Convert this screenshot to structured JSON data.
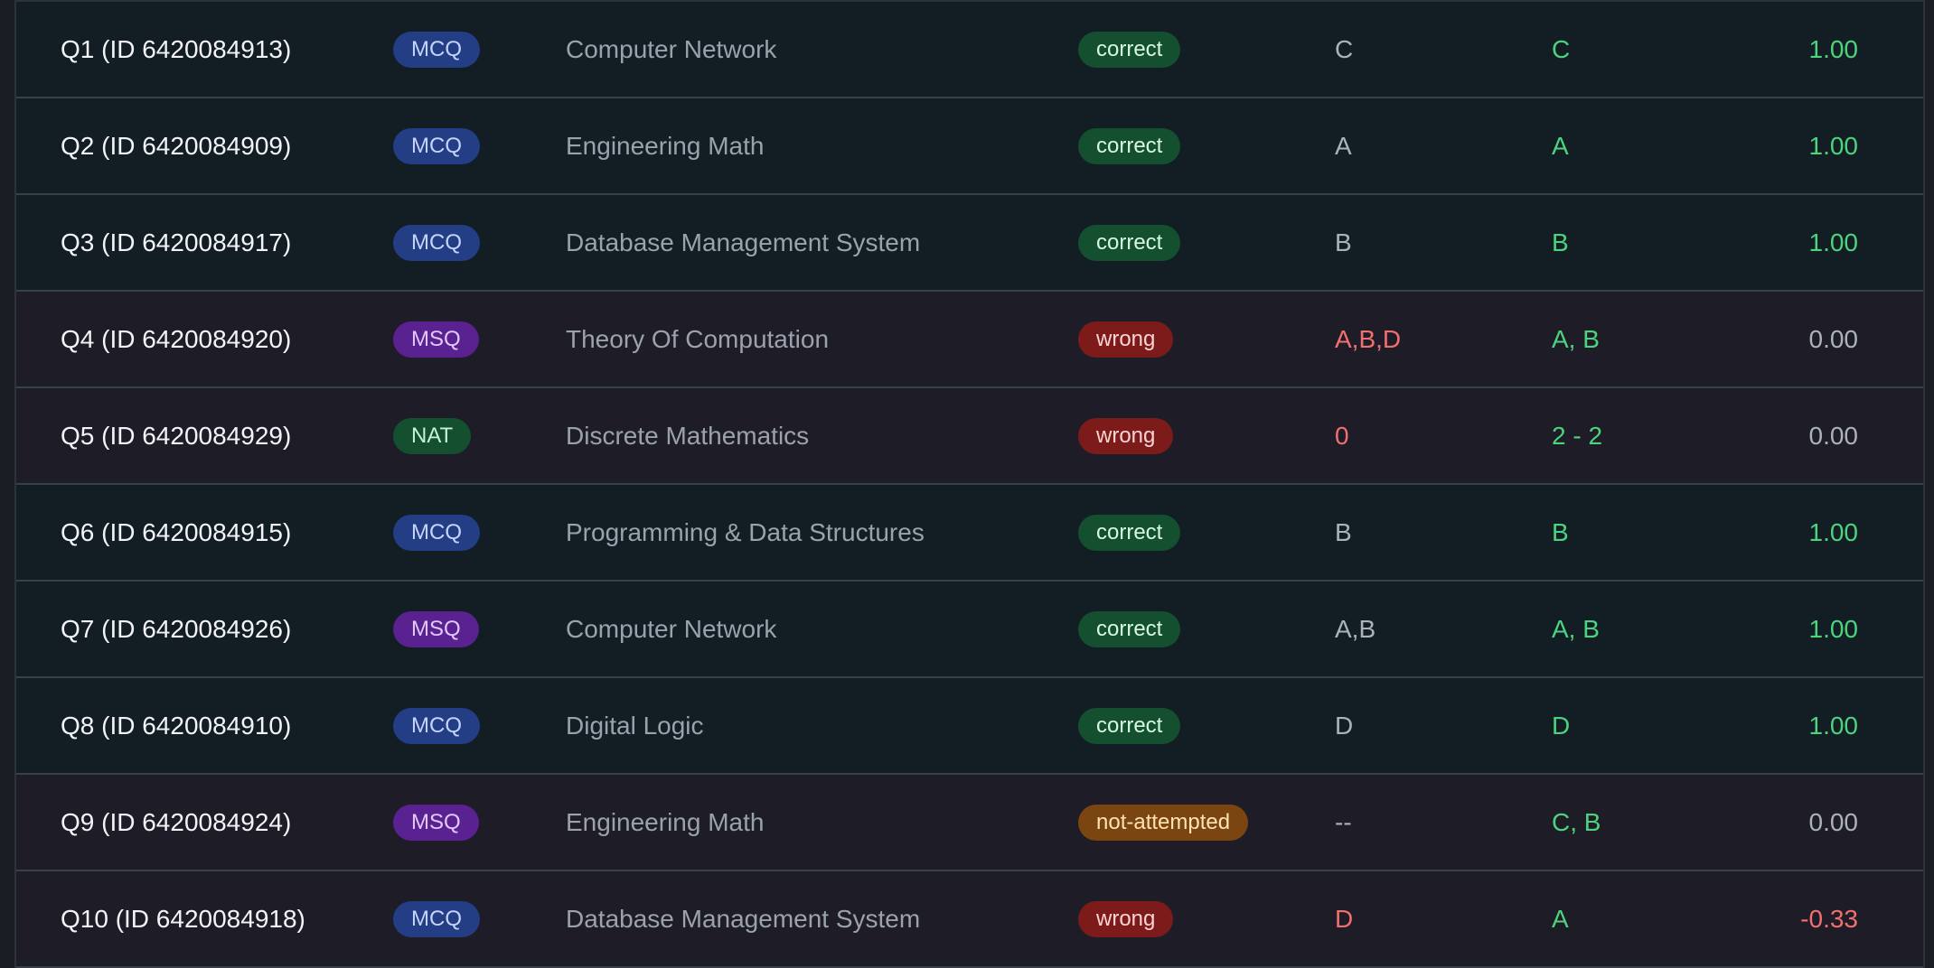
{
  "rows": [
    {
      "question": "Q1 (ID 6420084913)",
      "type": "MCQ",
      "subject": "Computer Network",
      "status": "correct",
      "given": "C",
      "answer": "C",
      "marks": "1.00"
    },
    {
      "question": "Q2 (ID 6420084909)",
      "type": "MCQ",
      "subject": "Engineering Math",
      "status": "correct",
      "given": "A",
      "answer": "A",
      "marks": "1.00"
    },
    {
      "question": "Q3 (ID 6420084917)",
      "type": "MCQ",
      "subject": "Database Management System",
      "status": "correct",
      "given": "B",
      "answer": "B",
      "marks": "1.00"
    },
    {
      "question": "Q4 (ID 6420084920)",
      "type": "MSQ",
      "subject": "Theory Of Computation",
      "status": "wrong",
      "given": "A,B,D",
      "answer": "A, B",
      "marks": "0.00"
    },
    {
      "question": "Q5 (ID 6420084929)",
      "type": "NAT",
      "subject": "Discrete Mathematics",
      "status": "wrong",
      "given": "0",
      "answer": "2 - 2",
      "marks": "0.00"
    },
    {
      "question": "Q6 (ID 6420084915)",
      "type": "MCQ",
      "subject": "Programming & Data Structures",
      "status": "correct",
      "given": "B",
      "answer": "B",
      "marks": "1.00"
    },
    {
      "question": "Q7 (ID 6420084926)",
      "type": "MSQ",
      "subject": "Computer Network",
      "status": "correct",
      "given": "A,B",
      "answer": "A, B",
      "marks": "1.00"
    },
    {
      "question": "Q8 (ID 6420084910)",
      "type": "MCQ",
      "subject": "Digital Logic",
      "status": "correct",
      "given": "D",
      "answer": "D",
      "marks": "1.00"
    },
    {
      "question": "Q9 (ID 6420084924)",
      "type": "MSQ",
      "subject": "Engineering Math",
      "status": "not-attempted",
      "given": "--",
      "answer": "C, B",
      "marks": "0.00"
    },
    {
      "question": "Q10 (ID 6420084918)",
      "type": "MCQ",
      "subject": "Database Management System",
      "status": "wrong",
      "given": "D",
      "answer": "A",
      "marks": "-0.33"
    }
  ],
  "colors": {
    "correct_row": "#121d24",
    "wrong_row": "#1e1c26",
    "positive": "#4cd37e",
    "negative": "#f16f6f",
    "neutral": "#aab2bb"
  }
}
